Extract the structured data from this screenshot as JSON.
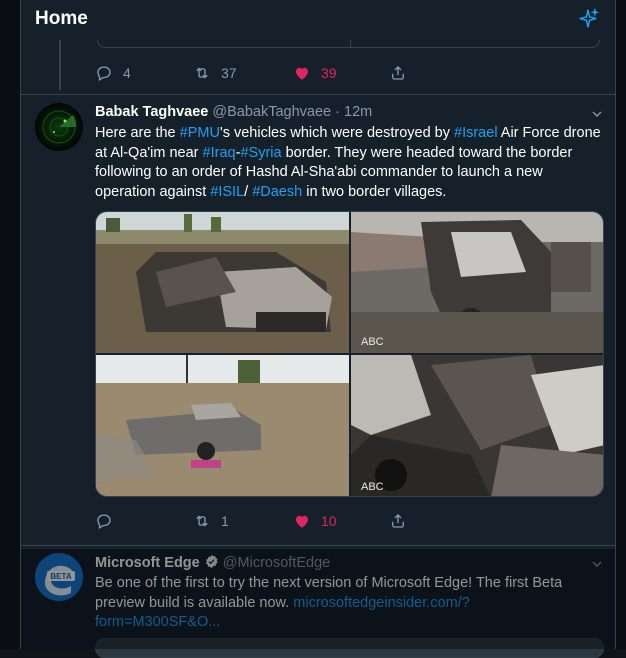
{
  "header": {
    "title": "Home",
    "sparkle_icon": "sparkle-icon"
  },
  "prev_tweet": {
    "replies": "4",
    "retweets": "37",
    "likes": "39"
  },
  "tweet": {
    "name": "Babak Taghvaee",
    "handle": "@BabakTaghvaee",
    "sep": "·",
    "time": "12m",
    "body": {
      "t1": "Here are the ",
      "tag1": "#PMU",
      "t2": "'s vehicles which were destroyed by ",
      "tag2": "#Israel",
      "t3": " Air Force drone at Al-Qa'im near ",
      "tag3": "#Iraq",
      "t4": "-",
      "tag4": "#Syria",
      "t5": " border. They were headed toward the border following to an order of Hashd Al-Sha'abi commander to launch a new operation against ",
      "tag5": "#ISIL",
      "t6": "/ ",
      "tag6": "#Daesh",
      "t7": " in two border villages."
    },
    "photo_watermark": "ABC",
    "replies": "",
    "retweets": "1",
    "likes": "10"
  },
  "ad": {
    "name": "Microsoft Edge",
    "handle": "@MicrosoftEdge",
    "avatar_text": "BETA",
    "body_text": "Be one of the first to try the next version of Microsoft Edge! The first Beta preview build is available now. ",
    "link": "microsoftedgeinsider.com/?form=M300SF&O..."
  },
  "colors": {
    "background": "#15202b",
    "accent": "#1da1f2",
    "like": "#e0245e",
    "muted": "#8899a6",
    "border": "#38444d"
  }
}
